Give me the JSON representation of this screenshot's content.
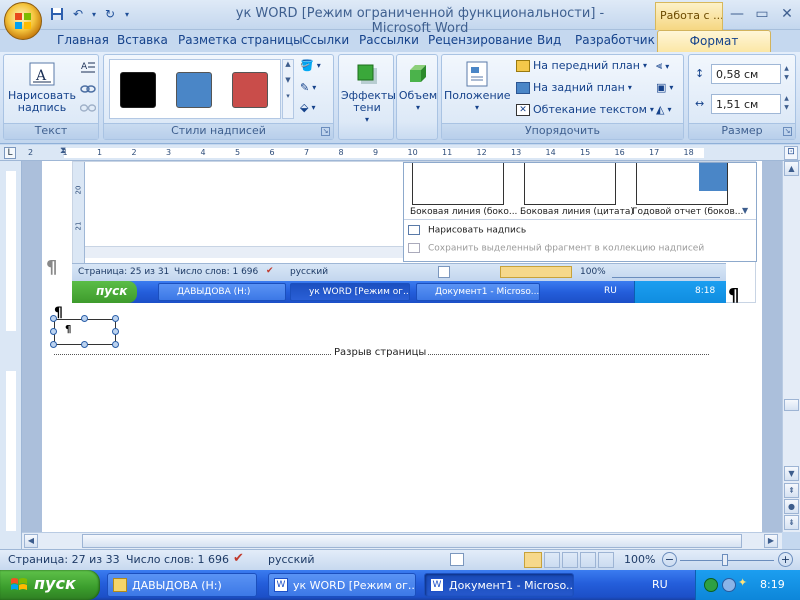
{
  "window": {
    "title": "ук WORD [Режим ограниченной функциональности] - Microsoft Word",
    "context_tools": "Работа с ...",
    "controls": [
      "minimize",
      "maximize",
      "close"
    ]
  },
  "tabs": [
    "Главная",
    "Вставка",
    "Разметка страницы",
    "Ссылки",
    "Рассылки",
    "Рецензирование",
    "Вид",
    "Разработчик",
    "Формат"
  ],
  "active_tab": "Формат",
  "ribbon": {
    "text_group": {
      "label": "Текст",
      "draw_textbox": "Нарисовать надпись"
    },
    "styles_group": {
      "label": "Стили надписей",
      "swatches": [
        "#000000",
        "#4a86c7",
        "#c94d4a"
      ]
    },
    "shadow": {
      "label": "Эффекты тени"
    },
    "volume": {
      "label": "Объем"
    },
    "arrange_group": {
      "label": "Упорядочить",
      "position": "Положение",
      "bring_front": "На передний план",
      "send_back": "На задний план",
      "wrap": "Обтекание текстом"
    },
    "size_group": {
      "label": "Размер",
      "height": "0,58 см",
      "width": "1,51 см"
    }
  },
  "ruler_ticks": [
    "2",
    "1",
    "1",
    "2",
    "3",
    "4",
    "5",
    "6",
    "7",
    "8",
    "9",
    "10",
    "11",
    "12",
    "13",
    "14",
    "15",
    "16",
    "17",
    "18"
  ],
  "document": {
    "inner_gallery_labels": [
      "Боковая линия (боко...",
      "Боковая линия (цитата)",
      "Годовой отчет (боков..."
    ],
    "inner_menu": {
      "draw": "Нарисовать надпись",
      "save": "Сохранить выделенный фрагмент в коллекцию надписей"
    },
    "inner_status": {
      "page": "Страница: 25 из 31",
      "words": "Число слов: 1 696",
      "lang": "русский",
      "zoom": "100%"
    },
    "inner_taskbar": {
      "start": "пуск",
      "items": [
        "ДАВЫДОВА (H:)",
        "ук WORD [Режим ог...",
        "Документ1 - Microso..."
      ],
      "lang": "RU",
      "time": "8:18"
    },
    "inner_ruler_nums": [
      "20",
      "21"
    ],
    "pilcrow": "¶",
    "page_break": "Разрыв страницы"
  },
  "status": {
    "page": "Страница: 27 из 33",
    "words": "Число слов: 1 696",
    "lang": "русский",
    "zoom": "100%"
  },
  "taskbar": {
    "start": "пуск",
    "items": [
      "ДАВЫДОВА (H:)",
      "ук WORD [Режим ог...",
      "Документ1 - Microso..."
    ],
    "lang": "RU",
    "time": "8:19"
  }
}
